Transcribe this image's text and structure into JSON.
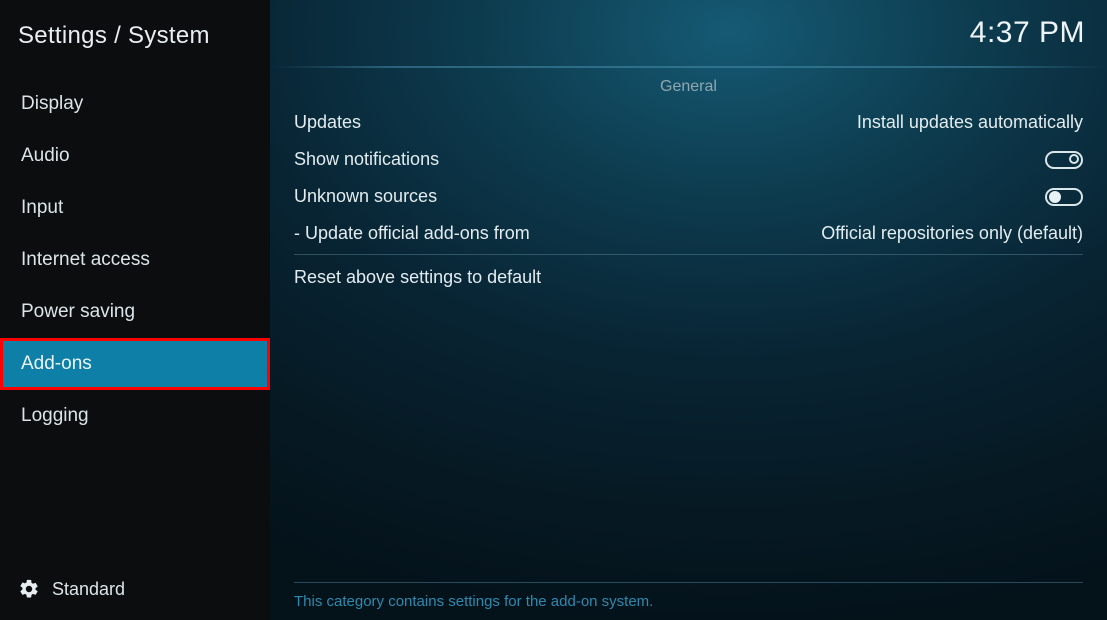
{
  "breadcrumb": "Settings / System",
  "clock": "4:37 PM",
  "sidebar": {
    "items": [
      {
        "label": "Display"
      },
      {
        "label": "Audio"
      },
      {
        "label": "Input"
      },
      {
        "label": "Internet access"
      },
      {
        "label": "Power saving"
      },
      {
        "label": "Add-ons"
      },
      {
        "label": "Logging"
      }
    ],
    "level": {
      "label": "Standard"
    }
  },
  "section": {
    "title": "General"
  },
  "settings": {
    "updates": {
      "label": "Updates",
      "value": "Install updates automatically"
    },
    "show_notifications": {
      "label": "Show notifications",
      "on": false
    },
    "unknown_sources": {
      "label": "Unknown sources",
      "on": true
    },
    "update_from": {
      "label": "Update official add-ons from",
      "value": "Official repositories only (default)"
    },
    "reset": {
      "label": "Reset above settings to default"
    }
  },
  "description": "This category contains settings for the add-on system."
}
